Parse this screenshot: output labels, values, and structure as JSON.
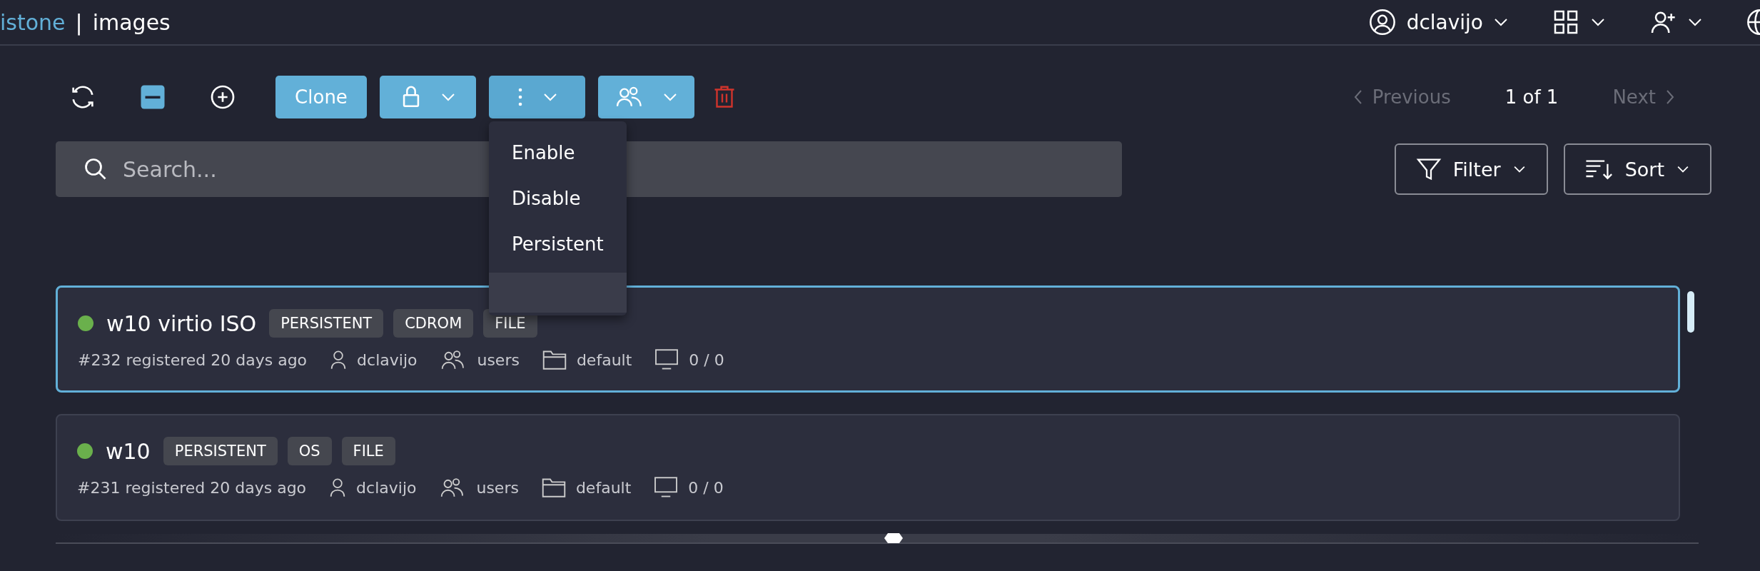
{
  "header": {
    "brand": "istone",
    "separator": "|",
    "section": "images",
    "user": "dclavijo"
  },
  "toolbar": {
    "clone_label": "Clone",
    "actions_expanded": true
  },
  "actions_menu": {
    "items": [
      {
        "label": "Enable",
        "hovered": false
      },
      {
        "label": "Disable",
        "hovered": false
      },
      {
        "label": "Persistent",
        "hovered": false
      }
    ],
    "blank_row_hovered": true
  },
  "pagination": {
    "previous": {
      "label": "Previous",
      "disabled": true
    },
    "page": "1 of 1",
    "next": {
      "label": "Next",
      "disabled": true
    }
  },
  "search": {
    "placeholder": "Search..."
  },
  "filter": {
    "label": "Filter"
  },
  "sort": {
    "label": "Sort"
  },
  "images": [
    {
      "name": "w10 virtio ISO",
      "color": "#6ab04c",
      "selected": true,
      "tags": [
        "PERSISTENT",
        "CDROM",
        "FILE"
      ],
      "registered": "#232 registered 20 days ago",
      "owner": "dclavijo",
      "group": "users",
      "category": "default",
      "usage": "0 / 0"
    },
    {
      "name": "w10",
      "color": "#6ab04c",
      "selected": false,
      "tags": [
        "PERSISTENT",
        "OS",
        "FILE"
      ],
      "registered": "#231 registered 20 days ago",
      "owner": "dclavijo",
      "group": "users",
      "category": "default",
      "usage": "0 / 0"
    }
  ]
}
